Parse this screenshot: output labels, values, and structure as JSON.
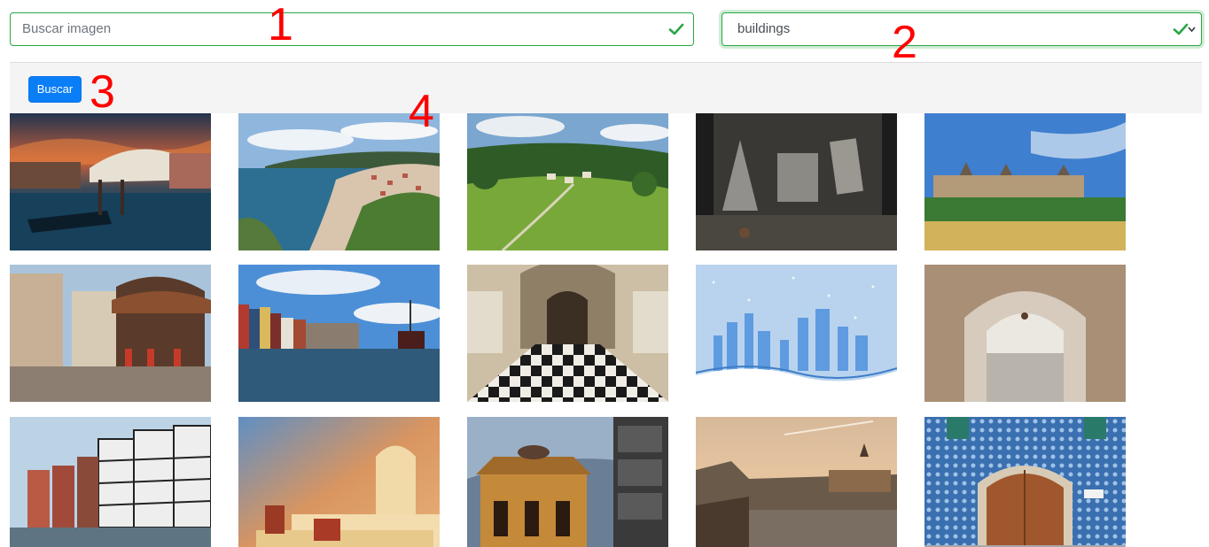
{
  "search": {
    "placeholder": "Buscar imagen",
    "value": ""
  },
  "category_select": {
    "selected": "buildings"
  },
  "toolbar": {
    "search_button_label": "Buscar"
  },
  "annotations": [
    "1",
    "2",
    "3",
    "4"
  ],
  "colors": {
    "valid_border": "#28a745",
    "primary_button": "#0a7ef7",
    "annotation": "#ff0000"
  },
  "gallery": {
    "rows": 3,
    "columns": 5,
    "images": [
      "venice-rialto-bridge-sunset",
      "coastal-village-bay",
      "green-valley-village",
      "dark-room-shower-light",
      "castle-behind-wheat-field",
      "old-town-carousel-street",
      "harbor-canal-with-ship",
      "palace-hall-checkered-floor",
      "blue-city-skyline-illustration",
      "stone-archway-passage",
      "half-timbered-riverside-houses",
      "white-greek-house-sunset",
      "stone-bell-tower-with-stork-nest",
      "prague-charles-bridge-dusk",
      "tiled-wall-wooden-door"
    ]
  }
}
